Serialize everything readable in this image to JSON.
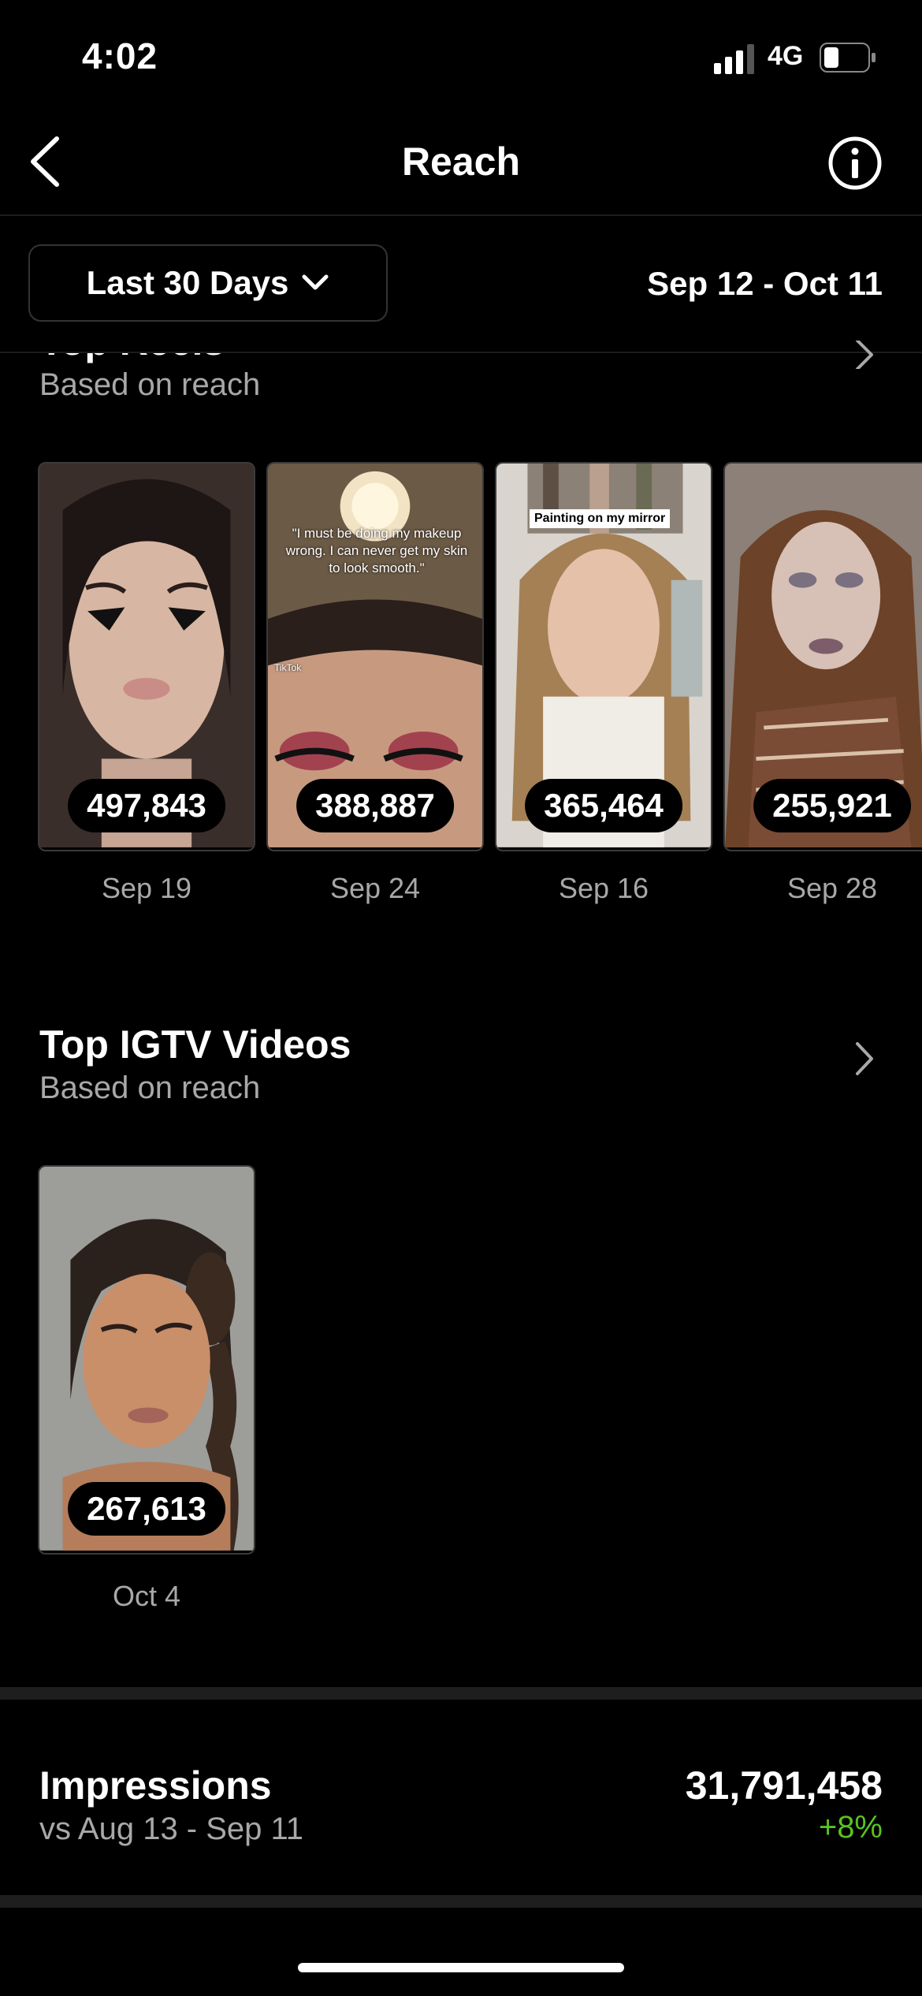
{
  "status_bar": {
    "time": "4:02",
    "network": "4G"
  },
  "header": {
    "title": "Reach"
  },
  "range": {
    "button_label": "Last 30 Days",
    "date_range": "Sep 12 - Oct 11"
  },
  "top_reels": {
    "title": "Top Reels",
    "subtitle": "Based on reach",
    "items": [
      {
        "value": "497,843",
        "date": "Sep 19"
      },
      {
        "value": "388,887",
        "date": "Sep 24",
        "overlay": "\"I must be doing my makeup wrong. I can never get my skin to look smooth.\"",
        "badge": "TikTok"
      },
      {
        "value": "365,464",
        "date": "Sep 16",
        "overlay": "Painting on my mirror"
      },
      {
        "value": "255,921",
        "date": "Sep 28"
      }
    ]
  },
  "top_igtv": {
    "title": "Top IGTV Videos",
    "subtitle": "Based on reach",
    "items": [
      {
        "value": "267,613",
        "date": "Oct 4"
      }
    ]
  },
  "impressions": {
    "label": "Impressions",
    "comparison": "vs Aug 13 - Sep 11",
    "value": "31,791,458",
    "change": "+8%",
    "change_color": "#58c322"
  }
}
